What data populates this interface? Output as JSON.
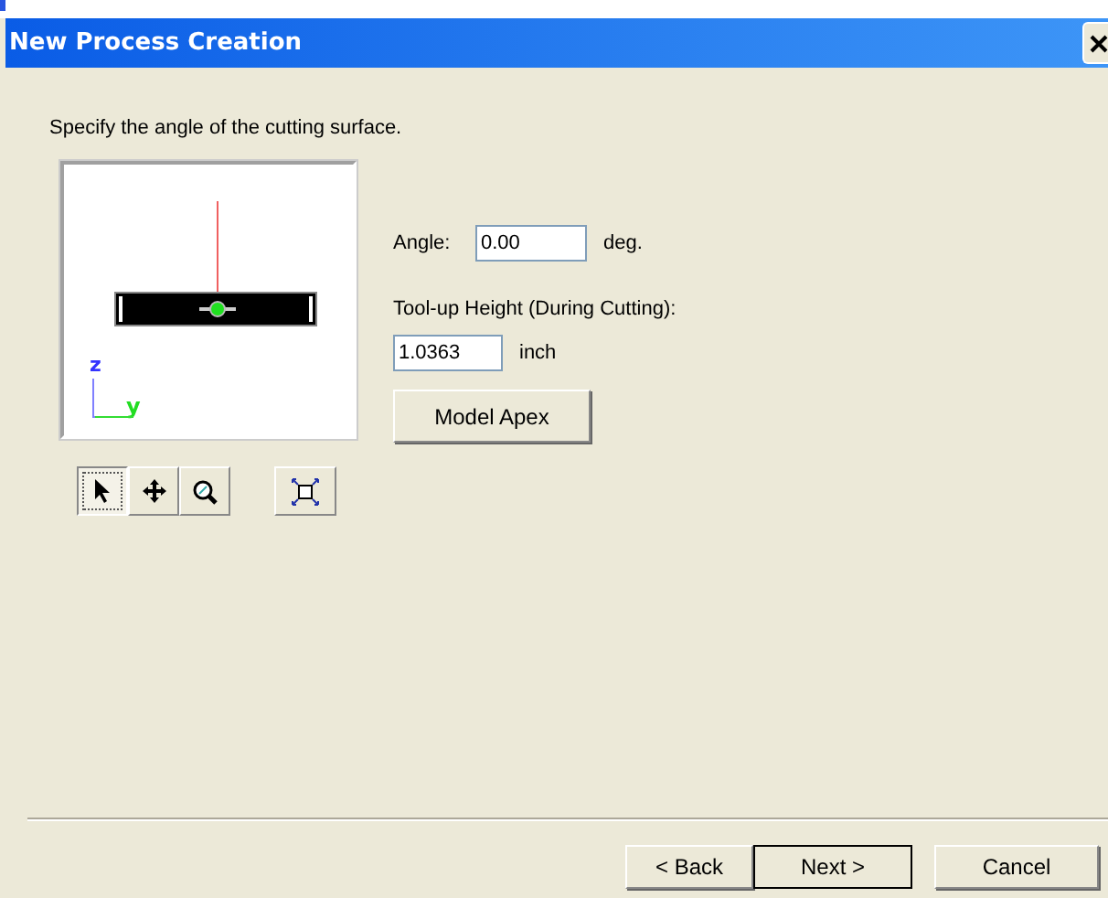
{
  "window": {
    "title": "New Process Creation"
  },
  "instruction": "Specify the angle of the cutting surface.",
  "viewport": {
    "axis_labels": [
      "z",
      "y"
    ]
  },
  "tools": [
    {
      "kind": "select",
      "selected": true
    },
    {
      "kind": "pan",
      "selected": false
    },
    {
      "kind": "zoom",
      "selected": false
    },
    {
      "kind": "fit",
      "selected": false
    }
  ],
  "angle": {
    "label": "Angle:",
    "value": "0.00",
    "unit": "deg."
  },
  "height": {
    "label": "Tool-up Height (During Cutting):",
    "value": "1.0363",
    "unit": "inch"
  },
  "model_apex_button": "Model Apex",
  "buttons": [
    {
      "label": "< Back",
      "default": false
    },
    {
      "label": "Next >",
      "default": true
    },
    {
      "label": "Cancel",
      "default": false
    }
  ]
}
